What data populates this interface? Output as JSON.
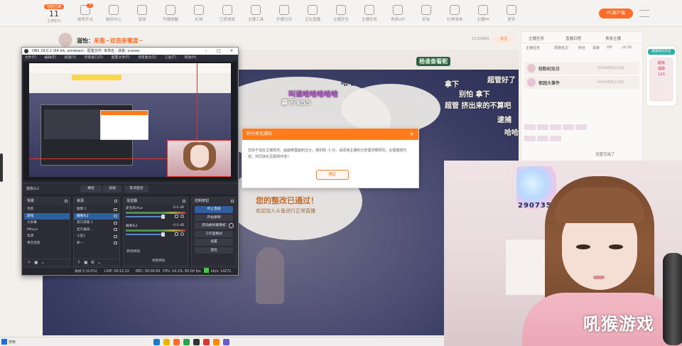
{
  "toolbar": {
    "level_badge": "钱包已满",
    "level_num": "11",
    "level_caption": "主播积分",
    "items": [
      {
        "label": "装修开关",
        "badge": "3"
      },
      {
        "label": "装扮中心",
        "badge": ""
      },
      {
        "label": "音频",
        "badge": ""
      },
      {
        "label": "开播提醒",
        "badge": ""
      },
      {
        "label": "礼物",
        "badge": ""
      },
      {
        "label": "已获成就",
        "badge": ""
      },
      {
        "label": "主播工具",
        "badge": ""
      },
      {
        "label": "开播日历",
        "badge": ""
      },
      {
        "label": "正在直播",
        "badge": ""
      },
      {
        "label": "主播安全",
        "badge": ""
      },
      {
        "label": "主播任务",
        "badge": ""
      },
      {
        "label": "贵族VIP",
        "badge": ""
      },
      {
        "label": "好友",
        "badge": ""
      },
      {
        "label": "礼物清单",
        "badge": ""
      },
      {
        "label": "主播PK",
        "badge": ""
      },
      {
        "label": "更多",
        "badge": ""
      }
    ],
    "pc_client": "PC客户端"
  },
  "room": {
    "title_prefix": "滋怡：",
    "title_highlight": "来惹~双倍亲蜜度~",
    "count": "1130880",
    "follow": "关注"
  },
  "overlay": {
    "banner": "杨谁奋看昵",
    "lines": [
      "拿下X55",
      "叫谁哈哈哈哈哈",
      "哈哈",
      "拿下",
      "别怕 拿下",
      "超管好了",
      "超管 挤出来的不算吧",
      "逮捕",
      "哈哈"
    ],
    "approve": "您的整改已通过！",
    "welcome": "欢迎加入斗鱼进行正常直播"
  },
  "notice": {
    "title": "积分变化通知",
    "close": "×",
    "body": "您由于违反主播规范，画面带露面积过大，被扣除 -1 分。请阅读主播积分管理详细规则，合理播放内容，共同净化互联网环境！",
    "ok": "确定"
  },
  "obs": {
    "title": "OBS 29.0.2 (64-bit, windows) - 配置文件: 未命名 - 场景: scenes",
    "menu": [
      "文件(F)",
      "编辑(E)",
      "视图(V)",
      "停靠窗口(D)",
      "配置文件(P)",
      "场景集合(S)",
      "工具(T)",
      "帮助(H)"
    ],
    "source_name": "摄像头2",
    "toolbar_buttons": [
      "属性",
      "滤镜",
      "取消激活"
    ],
    "docks": {
      "scenes": {
        "title": "场景",
        "items": [
          "场景",
          "游戏",
          "大屏幕",
          "MKoya",
          "高清",
          "青音场景"
        ],
        "selected": 1
      },
      "sources": {
        "title": "来源",
        "items": [
          "图像 2",
          "摄像头2",
          "窗口采集 2",
          "显示器采...",
          "斗鱼1",
          "移一"
        ],
        "selected": 1
      },
      "mixer": {
        "title": "混音器",
        "channels": [
          {
            "name": "麦克风/Aux",
            "level": "-0.0 dB"
          },
          {
            "name": "摄像头2",
            "level": "-0.0 dB"
          }
        ]
      },
      "transitions": {
        "title": "转场特效",
        "label": "场景特效"
      },
      "controls": {
        "title": "控制按钮",
        "buttons": [
          "停止直播",
          "开始录制",
          "启动虚拟摄像机",
          "工作室模式",
          "设置",
          "退出"
        ]
      }
    },
    "status": {
      "dropped": "丢帧 0 (0.0%)",
      "live": "LIVE: 00:12:52",
      "rec": "REC: 00:00:00",
      "cpu": "CPU: 14.1%, 60.00 fps",
      "kbps": "kb/s: 14272"
    }
  },
  "right_panel": {
    "tabs": [
      "主播任务",
      "直播日程",
      "贵族主播"
    ],
    "tab_sub": [
      "主播任务",
      "周榜名次",
      "粉丝",
      "贵族",
      "VIP",
      "LV.16"
    ],
    "rows": [
      {
        "label": "轻粉纪念日",
        "hint": "今日共有积分活动"
      },
      {
        "label": "家园大事件",
        "hint": "今日共有积分活动"
      }
    ],
    "side_head": "超级钱包开启",
    "side_card": [
      "超级",
      "福袋",
      "120"
    ],
    "bottom_link": "设置完成了"
  },
  "watermark": "吼猴游戏",
  "neon_number": "290735",
  "taskbar": {
    "search": "搜索"
  }
}
